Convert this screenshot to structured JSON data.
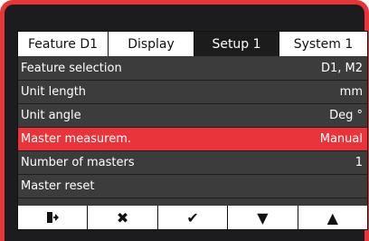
{
  "tabs": [
    {
      "label": "Feature  D1",
      "active": false
    },
    {
      "label": "Display",
      "active": false
    },
    {
      "label": "Setup 1",
      "active": true
    },
    {
      "label": "System 1",
      "active": false
    }
  ],
  "rows": [
    {
      "label": "Feature selection",
      "value": "D1, M2",
      "selected": false
    },
    {
      "label": "Unit length",
      "value": "mm",
      "selected": false
    },
    {
      "label": "Unit angle",
      "value": "Deg °",
      "selected": false
    },
    {
      "label": "Master measurem.",
      "value": "Manual",
      "selected": true
    },
    {
      "label": "Number of masters",
      "value": "1",
      "selected": false
    },
    {
      "label": "Master reset",
      "value": "",
      "selected": false
    }
  ],
  "toolbar": [
    {
      "icon": "exit-icon"
    },
    {
      "icon": "cancel-icon",
      "glyph": "✖"
    },
    {
      "icon": "confirm-icon",
      "glyph": "✔"
    },
    {
      "icon": "arrow-down-icon",
      "glyph": "▼"
    },
    {
      "icon": "arrow-up-icon",
      "glyph": "▲"
    }
  ],
  "colors": {
    "accent": "#e8343a",
    "background": "#3a3a3a",
    "frame": "#e53538"
  }
}
